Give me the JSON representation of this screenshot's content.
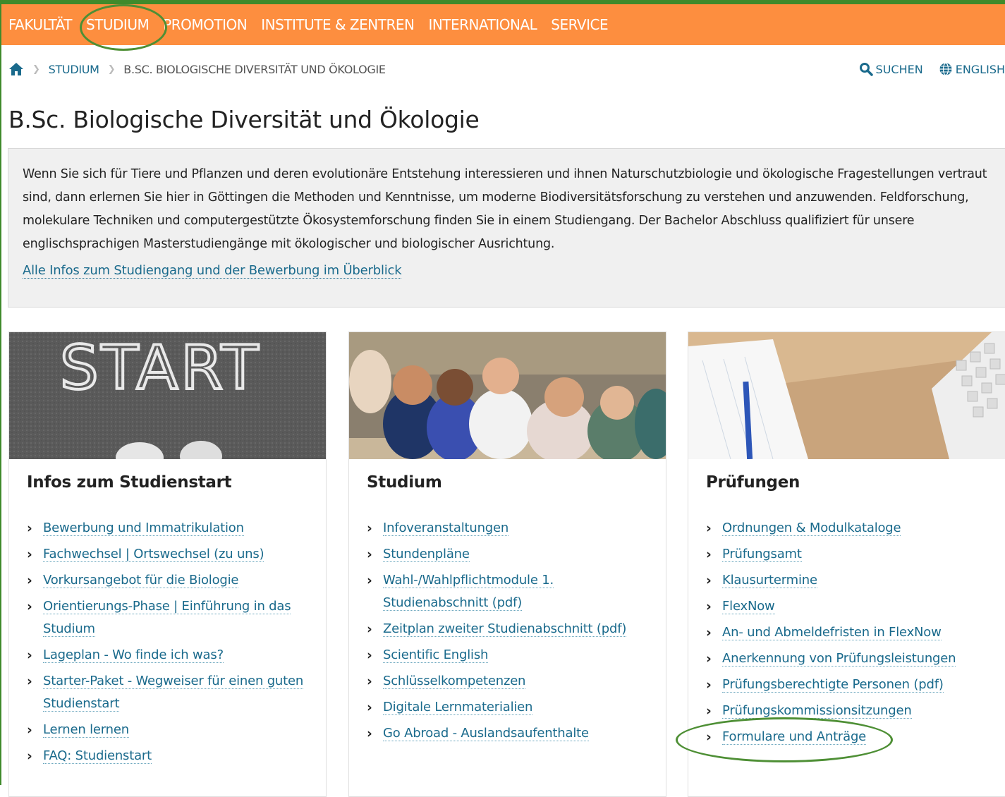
{
  "nav": {
    "items": [
      "FAKULTÄT",
      "STUDIUM",
      "PROMOTION",
      "INSTITUTE & ZENTREN",
      "INTERNATIONAL",
      "SERVICE"
    ]
  },
  "breadcrumb": {
    "home_icon": "home-icon",
    "items": [
      "STUDIUM",
      "B.SC. BIOLOGISCHE DIVERSITÄT UND ÖKOLOGIE"
    ]
  },
  "utility": {
    "search_label": "SUCHEN",
    "language_label": "ENGLISH"
  },
  "page_title": "B.Sc. Biologische Diversität und Ökologie",
  "intro": {
    "text": "Wenn Sie sich für Tiere und Pflanzen und deren evolutionäre Entstehung interessieren und ihnen Naturschutzbiologie und ökologische Fragestellungen vertraut sind, dann erlernen Sie hier in Göttingen die Methoden und Kenntnisse, um moderne Biodiversitätsforschung zu verstehen und anzuwenden. Feldforschung, molekulare Techniken und computergestützte Ökosystemforschung finden Sie in einem Studiengang. Der Bachelor Abschluss qualifiziert für unsere englischsprachigen Masterstudiengänge mit ökologischer und biologischer Ausrichtung.",
    "link": "Alle Infos zum Studiengang und der Bewerbung im Überblick"
  },
  "cards": [
    {
      "image_text": "START",
      "title": "Infos zum Studienstart",
      "links": [
        "Bewerbung und Immatrikulation",
        "Fachwechsel | Ortswechsel (zu uns)",
        "Vorkursangebot für die Biologie",
        "Orientierungs-Phase | Einführung in das Studium",
        "Lageplan - Wo finde ich was?",
        "Starter-Paket - Wegweiser für einen guten Studienstart",
        "Lernen lernen",
        "FAQ: Studienstart"
      ]
    },
    {
      "title": "Studium",
      "links": [
        "Infoveranstaltungen",
        "Stundenpläne",
        "Wahl-/Wahlpflichtmodule 1. Studienabschnitt (pdf)",
        "Zeitplan zweiter Studienabschnitt (pdf)",
        "Scientific English",
        "Schlüsselkompetenzen",
        "Digitale Lernmaterialien",
        "Go Abroad - Auslandsaufenthalte"
      ]
    },
    {
      "title": "Prüfungen",
      "links": [
        "Ordnungen & Modulkataloge",
        "Prüfungsamt",
        "Klausurtermine",
        "FlexNow",
        "An- und Abmeldefristen in FlexNow",
        "Anerkennung von Prüfungsleistungen",
        "Prüfungsberechtigte Personen (pdf)",
        "Prüfungskommissionsitzungen",
        "Formulare und Anträge"
      ]
    }
  ],
  "colors": {
    "nav_bg": "#fd8e3f",
    "link": "#1a6a8c",
    "highlight_circle": "#4e8f35"
  }
}
